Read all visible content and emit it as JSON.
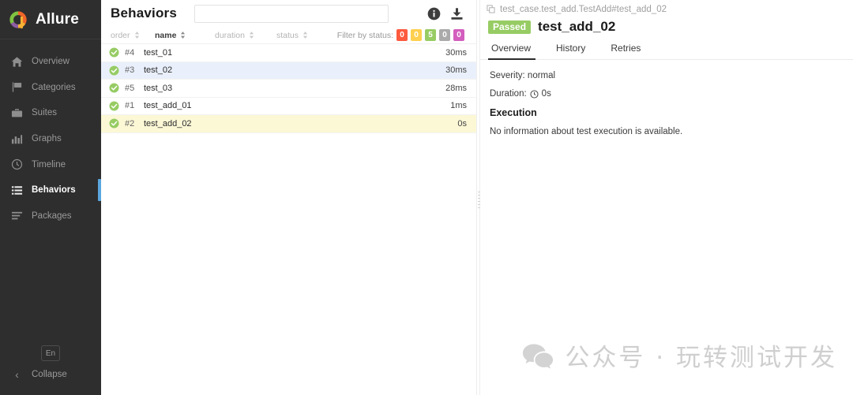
{
  "sidebar": {
    "brand": "Allure",
    "brand_logo_icon": "allure-logo-icon",
    "items": [
      {
        "label": "Overview",
        "icon": "home-icon"
      },
      {
        "label": "Categories",
        "icon": "flag-icon"
      },
      {
        "label": "Suites",
        "icon": "briefcase-icon"
      },
      {
        "label": "Graphs",
        "icon": "bar-chart-icon"
      },
      {
        "label": "Timeline",
        "icon": "clock-icon"
      },
      {
        "label": "Behaviors",
        "icon": "list-icon"
      },
      {
        "label": "Packages",
        "icon": "lines-icon"
      }
    ],
    "active_item": "Behaviors",
    "language_button": "En",
    "collapse_label": "Collapse",
    "collapse_icon": "chevron-left-icon",
    "active_indicator_color": "#5aa7e0"
  },
  "list_panel": {
    "title": "Behaviors",
    "search": {
      "value": "",
      "placeholder": ""
    },
    "info_icon": "info-circle-icon",
    "download_icon": "download-icon",
    "columns": [
      {
        "label": "order",
        "active": false
      },
      {
        "label": "name",
        "active": true
      },
      {
        "label": "duration",
        "active": false
      },
      {
        "label": "status",
        "active": false
      }
    ],
    "filter_label": "Filter by status:",
    "filter_badges": [
      {
        "value": "0",
        "color": "#fd5a3e",
        "status": "failed"
      },
      {
        "value": "0",
        "color": "#ffd050",
        "status": "broken"
      },
      {
        "value": "5",
        "color": "#97cc64",
        "status": "passed"
      },
      {
        "value": "0",
        "color": "#aaaaaa",
        "status": "skipped"
      },
      {
        "value": "0",
        "color": "#d35ebe",
        "status": "unknown"
      }
    ],
    "rows": [
      {
        "order": "#4",
        "name": "test_01",
        "duration": "30ms",
        "status": "passed",
        "highlight": "none"
      },
      {
        "order": "#3",
        "name": "test_02",
        "duration": "30ms",
        "status": "passed",
        "highlight": "blue"
      },
      {
        "order": "#5",
        "name": "test_03",
        "duration": "28ms",
        "status": "passed",
        "highlight": "none"
      },
      {
        "order": "#1",
        "name": "test_add_01",
        "duration": "1ms",
        "status": "passed",
        "highlight": "none"
      },
      {
        "order": "#2",
        "name": "test_add_02",
        "duration": "0s",
        "status": "passed",
        "highlight": "yellow"
      }
    ]
  },
  "detail": {
    "breadcrumb": "test_case.test_add.TestAdd#test_add_02",
    "breadcrumb_icon": "copy-icon",
    "status_badge": "Passed",
    "status_badge_color": "#97cc64",
    "title": "test_add_02",
    "tabs": [
      {
        "label": "Overview",
        "active": true
      },
      {
        "label": "History",
        "active": false
      },
      {
        "label": "Retries",
        "active": false
      }
    ],
    "severity": "Severity: normal",
    "duration_label": "Duration:",
    "duration_value": "0s",
    "duration_icon": "clock-icon",
    "execution_heading": "Execution",
    "execution_text": "No information about test execution is available."
  },
  "watermark": {
    "icon": "wechat-icon",
    "text": "公众号 · 玩转测试开发"
  }
}
